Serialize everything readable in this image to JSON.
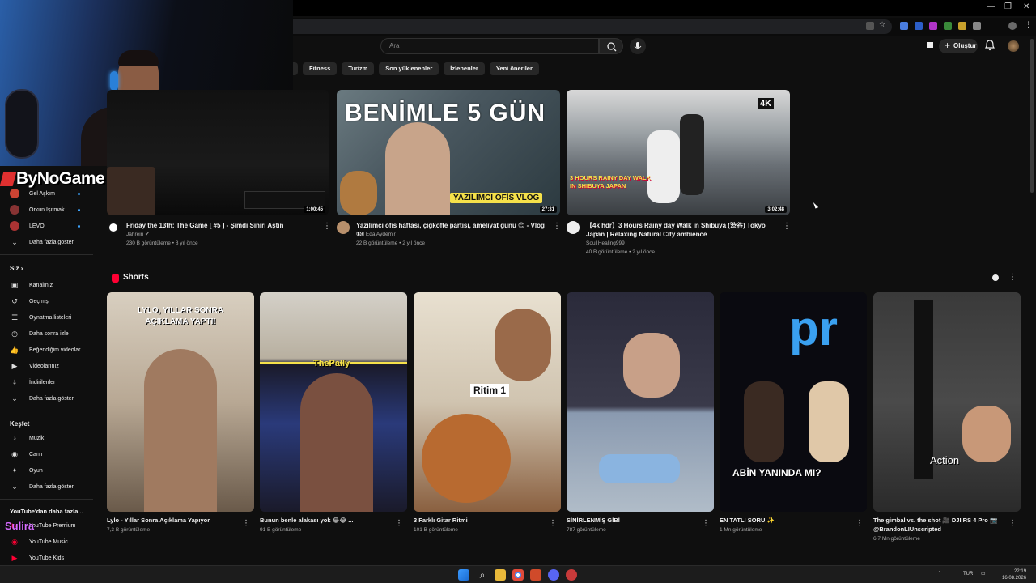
{
  "search": {
    "placeholder": "Ara"
  },
  "topbar": {
    "create_label": "Oluştur"
  },
  "chips": [
    "Fitness",
    "Turizm",
    "Son yüklenenler",
    "İzlenenler",
    "Yeni öneriler"
  ],
  "overlay": {
    "logo_text": "ByNoGame",
    "name_text": "Sulira"
  },
  "sidebar": {
    "subscriptions": [
      {
        "label": "Gel Aşkım",
        "color": "#c43"
      },
      {
        "label": "Orkun Işıtmak",
        "color": "#833"
      },
      {
        "label": "LEVO",
        "color": "#a33"
      }
    ],
    "show_more_1": "Daha fazla göster",
    "you_heading": "Siz",
    "you_items": [
      {
        "label": "Kanalınız",
        "icon": "channel-icon"
      },
      {
        "label": "Geçmiş",
        "icon": "history-icon"
      },
      {
        "label": "Oynatma listeleri",
        "icon": "playlist-icon"
      },
      {
        "label": "Daha sonra izle",
        "icon": "watch-later-icon"
      },
      {
        "label": "Beğendiğim videolar",
        "icon": "like-icon"
      },
      {
        "label": "Videolarınız",
        "icon": "video-icon"
      },
      {
        "label": "İndirilenler",
        "icon": "download-icon"
      }
    ],
    "show_more_2": "Daha fazla göster",
    "explore_heading": "Keşfet",
    "explore_items": [
      {
        "label": "Müzik",
        "icon": "music-icon"
      },
      {
        "label": "Canlı",
        "icon": "live-icon"
      },
      {
        "label": "Oyun",
        "icon": "gaming-icon"
      }
    ],
    "show_more_3": "Daha fazla göster",
    "more_heading": "YouTube'dan daha fazla...",
    "more_items": [
      {
        "label": "YouTube Premium",
        "color": "#f03"
      },
      {
        "label": "YouTube Music",
        "color": "#f03"
      },
      {
        "label": "YouTube Kids",
        "color": "#f03"
      }
    ]
  },
  "videos": [
    {
      "title": "Friday the 13th: The Game [ #5 ] - Şimdi Sınırı Aştın",
      "channel": "Jahrein ✔",
      "meta": "230 B görüntüleme • 8 yıl önce",
      "duration": "1:00:45"
    },
    {
      "title": "Yazılımcı ofis haftası, çiğköfte partisi, ameliyat günü 😊 - Vlog 13",
      "channel": "Gül Eda Aydemir",
      "meta": "22 B görüntüleme • 2 yıl önce",
      "duration": "27:31",
      "thumb_text": "BENİMLE 5 GÜN",
      "thumb_sub": "YAZILIMCI OFİS VLOG"
    },
    {
      "title": "【4k hdr】3 Hours Rainy day Walk in Shibuya (渋谷) Tokyo Japan | Relaxing Natural City ambience",
      "channel": "Soul Healing999",
      "meta": "40 B görüntüleme • 2 yıl önce",
      "duration": "3:02:48",
      "thumb_badge": "4K",
      "thumb_sub": "3 HOURS RAINY DAY WALK IN SHIBUYA JAPAN"
    }
  ],
  "shorts": {
    "heading": "Shorts",
    "items": [
      {
        "title": "Lylo - Yıllar Sonra Açıklama Yapıyor",
        "meta": "7,3 B görüntüleme",
        "overlay": "LYLO, YILLAR SONRA AÇIKLAMA YAPTI!"
      },
      {
        "title": "Bunun benle alakası yok 😂😂 ...",
        "meta": "91 B görüntüleme",
        "overlay": "ThePally"
      },
      {
        "title": "3 Farklı Gitar Ritmi",
        "meta": "101 B görüntüleme",
        "overlay": "Ritim 1"
      },
      {
        "title": "SİNİRLENMİŞ GİBİ",
        "meta": "787 görüntüleme",
        "overlay": ""
      },
      {
        "title": "EN TATLI SORU ✨",
        "meta": "1 Mn görüntüleme",
        "overlay": "ABİN YANINDA MI?"
      },
      {
        "title": "The gimbal vs. the shot 🎥 DJI RS 4 Pro 📷 @BrandonLIUnscripted",
        "meta": "6,7 Mn görüntüleme",
        "overlay": "Action"
      }
    ]
  },
  "taskbar": {
    "lang": "TUR",
    "time": "22:19",
    "date": "16.08.2026"
  }
}
